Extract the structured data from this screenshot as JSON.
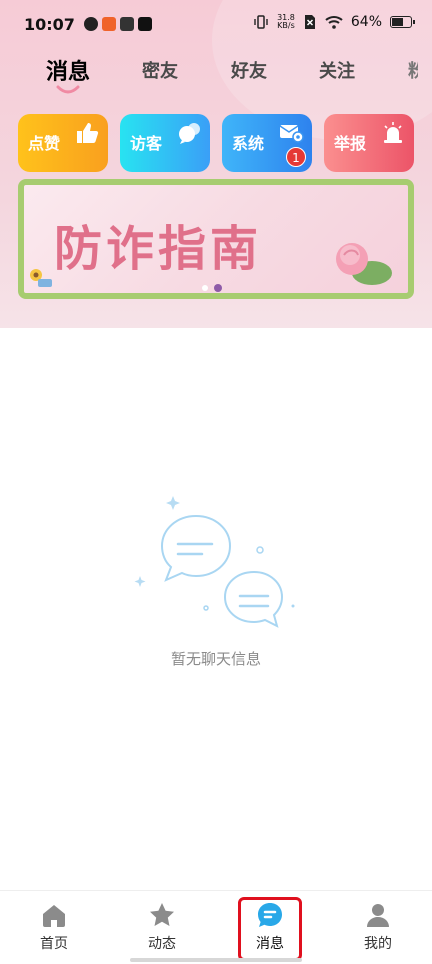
{
  "status_bar": {
    "time": "10:07",
    "net_speed_value": "31.8",
    "net_speed_unit": "KB/s",
    "battery": "64%",
    "battery_level": 0.64
  },
  "tabs": [
    {
      "label": "消息",
      "active": true
    },
    {
      "label": "密友",
      "active": false
    },
    {
      "label": "好友",
      "active": false
    },
    {
      "label": "关注",
      "active": false
    }
  ],
  "cards": [
    {
      "label": "点赞",
      "icon": "thumbs-up-icon",
      "color_from": "#ffbf1a",
      "color_to": "#f9a51d"
    },
    {
      "label": "访客",
      "icon": "chat-bubble-icon",
      "color_from": "#27e0f0",
      "color_to": "#3aa3f7"
    },
    {
      "label": "系统",
      "icon": "mail-gear-icon",
      "badge": "1",
      "color_from": "#3eb2f8",
      "color_to": "#2f86ef"
    },
    {
      "label": "举报",
      "icon": "alarm-icon",
      "color_from": "#fa8c8c",
      "color_to": "#ef5a6a"
    }
  ],
  "banner": {
    "title": "防诈指南",
    "border_color": "#a7cc70",
    "active_slide": 2,
    "slide_count": 2
  },
  "empty_state": {
    "text": "暂无聊天信息",
    "icon": "chat-bubbles-icon"
  },
  "bottom_nav": [
    {
      "label": "首页",
      "icon": "home-icon",
      "active": false
    },
    {
      "label": "动态",
      "icon": "star-icon",
      "active": false
    },
    {
      "label": "消息",
      "icon": "message-icon",
      "active": true
    },
    {
      "label": "我的",
      "icon": "person-icon",
      "active": false
    }
  ],
  "colors": {
    "accent_blue": "#29a8e8",
    "highlight_red": "#e0101e",
    "nav_gray": "#8b8b8b"
  }
}
